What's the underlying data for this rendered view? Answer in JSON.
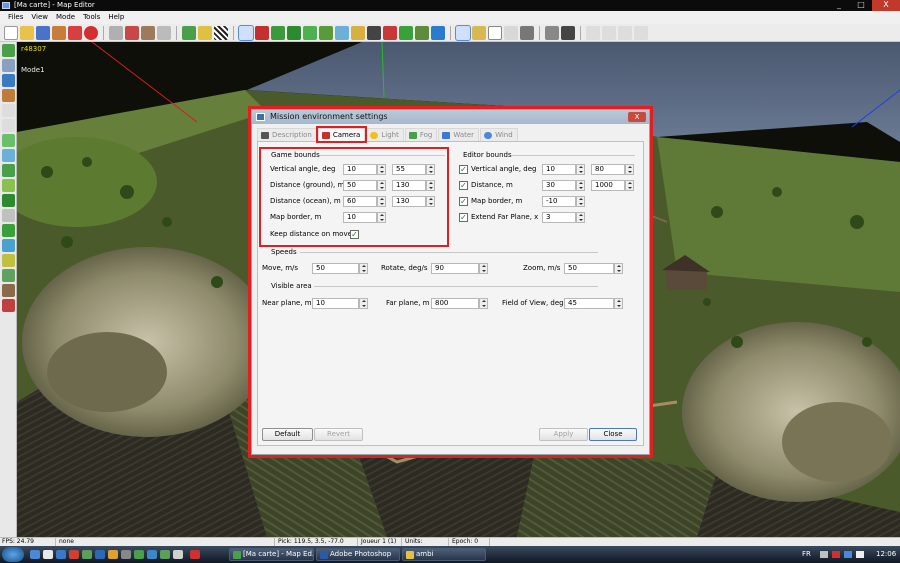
{
  "window": {
    "title": "[Ma carte] - Map Editor",
    "controls": [
      "_",
      "□",
      "X"
    ]
  },
  "menu": [
    "Files",
    "View",
    "Mode",
    "Tools",
    "Help"
  ],
  "viewport": {
    "code": "r48307",
    "mode": "Mode1"
  },
  "dialog": {
    "title": "Mission environment settings",
    "close": "X",
    "tabs": [
      "Description",
      "Camera",
      "Light",
      "Fog",
      "Water",
      "Wind"
    ],
    "active_tab": "Camera",
    "game_bounds": {
      "label": "Game bounds",
      "vertical_angle": {
        "label": "Vertical angle, deg",
        "min": "10",
        "max": "55"
      },
      "distance_ground": {
        "label": "Distance (ground), m",
        "min": "50",
        "max": "130"
      },
      "distance_ocean": {
        "label": "Distance (ocean), m",
        "min": "60",
        "max": "130"
      },
      "map_border": {
        "label": "Map border, m",
        "value": "10"
      },
      "keep_distance": {
        "label": "Keep distance on move",
        "checked": "✓"
      }
    },
    "editor_bounds": {
      "label": "Editor bounds",
      "vertical_angle": {
        "label": "Vertical angle, deg",
        "min": "10",
        "max": "80",
        "checked": "✓"
      },
      "distance": {
        "label": "Distance, m",
        "min": "30",
        "max": "1000",
        "checked": "✓"
      },
      "map_border": {
        "label": "Map border, m",
        "value": "-10",
        "checked": "✓"
      },
      "extend_far_plane": {
        "label": "Extend Far Plane, x",
        "value": "3",
        "checked": "✓"
      }
    },
    "speeds": {
      "label": "Speeds",
      "move": {
        "label": "Move, m/s",
        "value": "50"
      },
      "rotate": {
        "label": "Rotate, deg/s",
        "value": "90"
      },
      "zoom": {
        "label": "Zoom, m/s",
        "value": "50"
      }
    },
    "visible_area": {
      "label": "Visible area",
      "near_plane": {
        "label": "Near plane, m",
        "value": "10"
      },
      "far_plane": {
        "label": "Far plane, m",
        "value": "800"
      },
      "fov": {
        "label": "Field of View, deg",
        "value": "45"
      }
    },
    "buttons": {
      "default": "Default",
      "revert": "Revert",
      "apply": "Apply",
      "close": "Close"
    }
  },
  "statusbar": {
    "fps": "FPS: 24.79",
    "selection": "none",
    "pick": "Pick: 119.5, 3.5, -77.0",
    "player": "Joueur 1 (1)",
    "units": "Units:",
    "epoch": "Epoch: 0"
  },
  "taskbar": {
    "tasks": [
      "[Ma carte] - Map Ed...",
      "Adobe Photoshop",
      "ambi"
    ],
    "lang": "FR",
    "clock": "12:06"
  },
  "colors": {
    "highlight": "#e02020",
    "title_bar": "#0b0b0b",
    "overlay_text": "#e8e000"
  }
}
